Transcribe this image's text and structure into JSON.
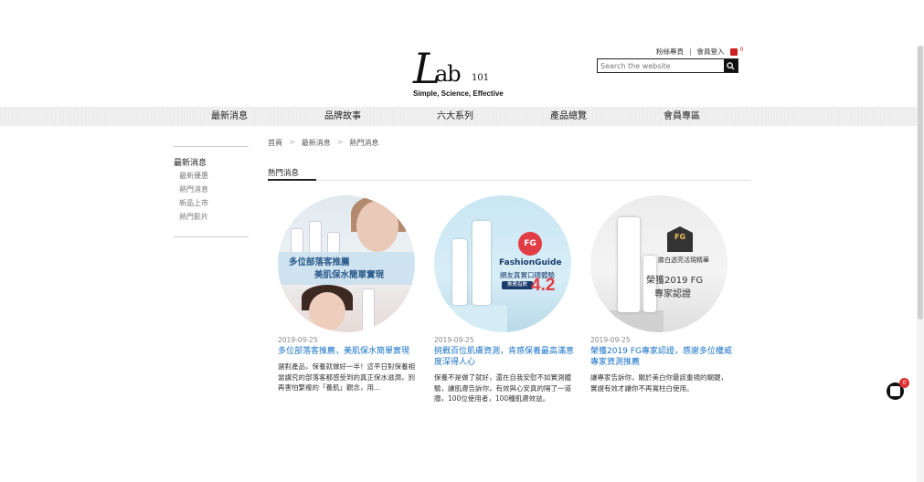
{
  "brand": {
    "logo_l": "L",
    "logo_ab": "ab",
    "logo_num": "101",
    "tagline": "Simple, Science, Effective"
  },
  "top_links": {
    "shop": "粉絲專頁",
    "member_login": "會員登入",
    "cart_count": "0"
  },
  "search": {
    "placeholder": "Search the website"
  },
  "nav": [
    "最新消息",
    "品牌故事",
    "六大系列",
    "產品總覽",
    "會員專區"
  ],
  "sidebar": {
    "title": "最新消息",
    "items": [
      "最新優惠",
      "熱門消息",
      "新品上市",
      "熱門影片"
    ]
  },
  "breadcrumb": [
    "首頁",
    "最新消息",
    "熱門消息"
  ],
  "section_title": "熱門消息",
  "cards": [
    {
      "image": {
        "line1": "多位部落客推薦",
        "line2": "美肌保水簡單實現"
      },
      "date": "2019-09-25",
      "title": "多位部落客推薦，美肌保水簡單實現",
      "desc": "選對產品，保養就做好一半！這平日對保養相當講究的部落客都感受到的真正保水滋潤，別再害怕繁複的「養肌」觀念，用..."
    },
    {
      "image": {
        "fg": "FG",
        "fg_name": "FashionGuide",
        "fg_sub": "網友真實口碑體驗",
        "pill": "推薦指數",
        "score": "4.2"
      },
      "date": "2019-09-25",
      "title": "挑戰百位肌膚資測，肯感保養最高滿意度深得人心",
      "desc": "保養不是做了就好，還在自我安慰不如實測體驗，讓肌膚告訴你，有效與心安真的隔了一道牆，100位使用者，100種肌膚效益。"
    },
    {
      "image": {
        "shield": "FG",
        "label": "膝白透亮活現精華",
        "line1": "榮獲2019 FG",
        "line2": "專家認證"
      },
      "date": "2019-09-25",
      "title": "榮獲2019 FG專家認證，感謝多位權威專家資測推薦",
      "desc": "讓專家告訴你，關於美白你最該重視的關鍵，實證有效才讓你不再寬柱白使用。"
    }
  ],
  "float_cart": {
    "count": "0"
  }
}
